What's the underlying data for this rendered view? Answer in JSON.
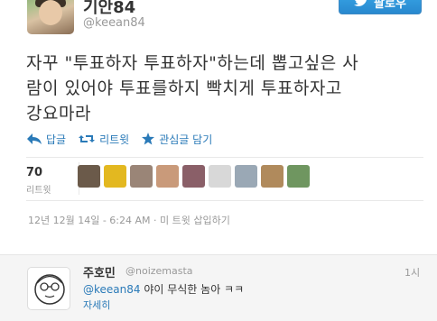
{
  "author": {
    "display_name": "기안84",
    "handle": "@keean84"
  },
  "follow_button": {
    "label": "팔로우"
  },
  "tweet": {
    "lines": [
      "자꾸 \"투표하자 투표하자\"하는데 뽑고싶은 사",
      "람이 있어야 투표를하지 빡치게 투표하자고",
      "강요마라"
    ]
  },
  "actions": {
    "reply": "답글",
    "retweet": "리트윗",
    "favorite": "관심글 담기"
  },
  "stats": {
    "retweets_count": "70",
    "retweets_label": "리트윗"
  },
  "timestamp": "12년 12월 14일 - 6:24 AM · 미 트윗 삽입하기",
  "reply": {
    "name": "주호민",
    "handle": "@noizemasta",
    "time": "1시",
    "mention": "@keean84",
    "text": " 야이 무식한 놈아 ㅋㅋ",
    "expand": "자세히"
  },
  "colors": {
    "link": "#2a7ab8",
    "follow_button": "#2888cf",
    "reply_panel_bg": "#f5f5f5"
  },
  "retweeter_avatars": [
    {
      "icon": "avatar-1",
      "color": "#6b5a4a"
    },
    {
      "icon": "avatar-2",
      "color": "#e3b820"
    },
    {
      "icon": "avatar-3",
      "color": "#9a8577"
    },
    {
      "icon": "avatar-4",
      "color": "#c99a7a"
    },
    {
      "icon": "avatar-5",
      "color": "#8a5f68"
    },
    {
      "icon": "avatar-6",
      "color": "#d8d8d8"
    },
    {
      "icon": "avatar-7",
      "color": "#9aa8b5"
    },
    {
      "icon": "avatar-8",
      "color": "#b08a5c"
    },
    {
      "icon": "avatar-9",
      "color": "#6f9660"
    }
  ]
}
